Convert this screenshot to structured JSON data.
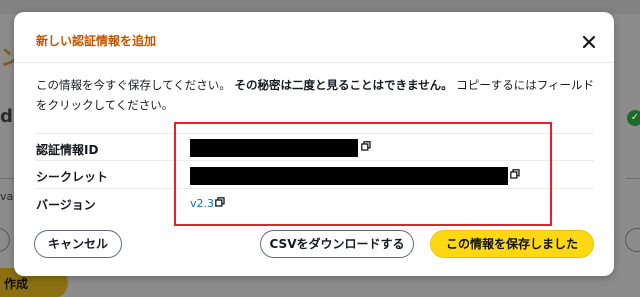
{
  "background": {
    "title_fragment": "ン",
    "label_fragment": "d:",
    "small_text_fragment": "va",
    "button_fragment": "作成",
    "check_symbol": "✓"
  },
  "modal": {
    "title": "新しい認証情報を追加",
    "description": {
      "part1": "この情報を今すぐ保存してください。",
      "bold": "その秘密は二度と見ることはできません。",
      "part2": "コピーするにはフィールドをクリックしてください。"
    },
    "fields": [
      {
        "label": "認証情報ID",
        "value": ""
      },
      {
        "label": "シークレット",
        "value": ""
      },
      {
        "label": "バージョン",
        "value": "v2.3"
      }
    ]
  },
  "buttons": {
    "cancel": "キャンセル",
    "download_csv": "CSVをダウンロードする",
    "saved": "この情報を保存しました"
  },
  "colors": {
    "title": "#c45500",
    "primary_button": "#ffd814",
    "link": "#0972d3",
    "highlight": "#e8202a"
  }
}
